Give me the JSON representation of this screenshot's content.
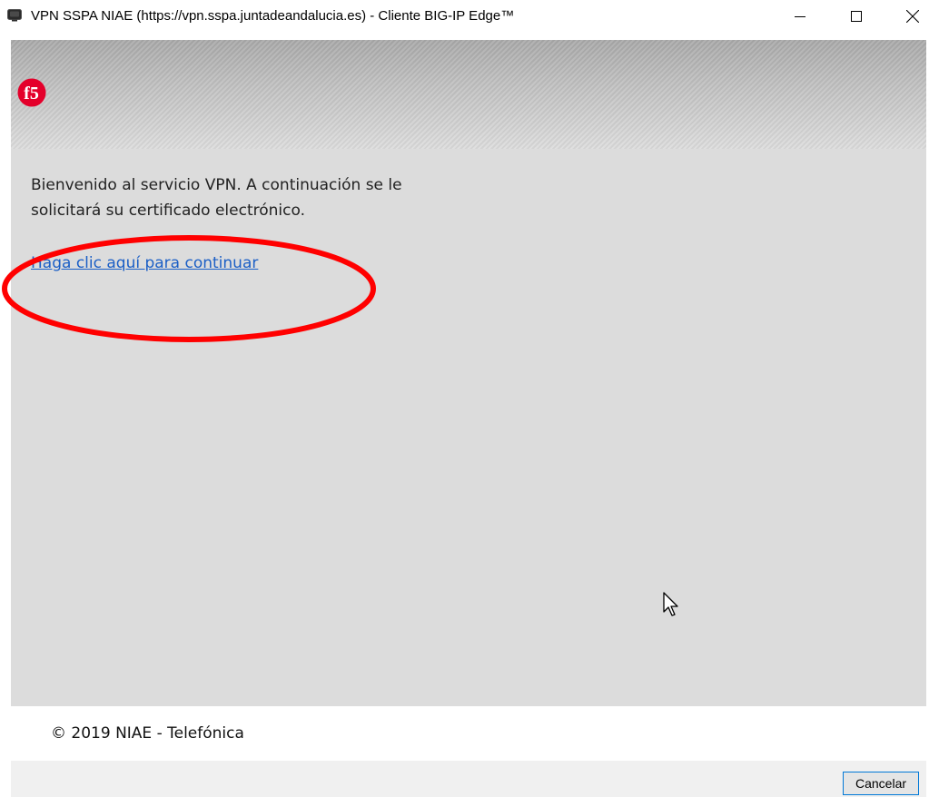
{
  "window": {
    "title": "VPN SSPA NIAE (https://vpn.sspa.juntadeandalucia.es) - Cliente BIG-IP Edge™",
    "app_icon": "monitor-shield-icon",
    "controls": {
      "minimize_icon": "minimize-icon",
      "maximize_icon": "maximize-icon",
      "close_icon": "close-icon"
    }
  },
  "header": {
    "logo": "f5-logo-icon",
    "logo_text": "f5",
    "logo_color": "#e4002b"
  },
  "main": {
    "welcome_text": "Bienvenido al servicio VPN. A continuación se le solicitará su certificado electrónico.",
    "continue_link": "Haga clic aquí para continuar",
    "link_color": "#1b5fc6",
    "annotation_color": "#ff0000"
  },
  "footer": {
    "copyright": "© 2019 NIAE - Telefónica"
  },
  "buttons": {
    "cancel_label": "Cancelar"
  }
}
